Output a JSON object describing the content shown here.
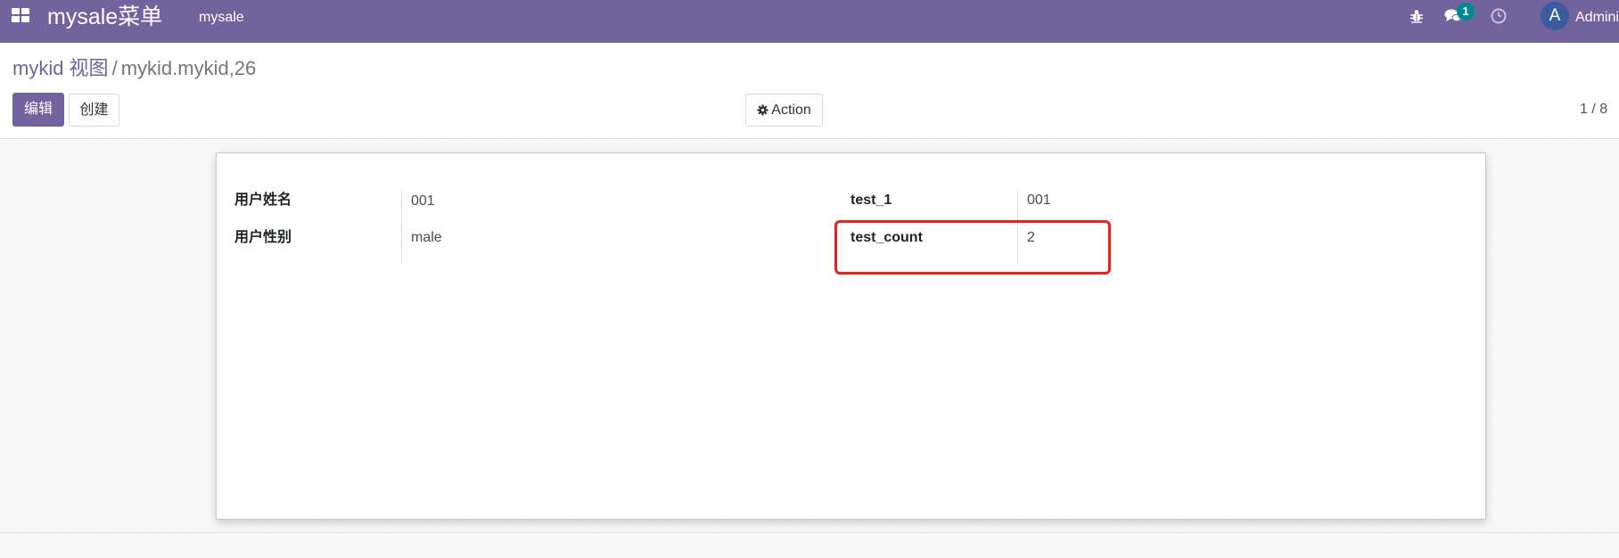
{
  "navbar": {
    "app_name": "mysale菜单",
    "menu_item": "mysale",
    "chat_badge_count": "1",
    "avatar_initial": "A",
    "user_name": "Administrator"
  },
  "breadcrumb": {
    "parent": "mykid 视图",
    "separator": "/",
    "current": "mykid.mykid,26"
  },
  "buttons": {
    "edit": "编辑",
    "create": "创建",
    "action": "Action"
  },
  "pager": "1 / 8",
  "form": {
    "left": [
      {
        "label": "用户姓名",
        "value": "001"
      },
      {
        "label": "用户性别",
        "value": "male"
      }
    ],
    "right": [
      {
        "label": "test_1",
        "value": "001"
      },
      {
        "label": "test_count",
        "value": "2"
      }
    ]
  },
  "colors": {
    "brand": "#71639e",
    "badge": "#01878f",
    "highlight": "#e8231f"
  }
}
